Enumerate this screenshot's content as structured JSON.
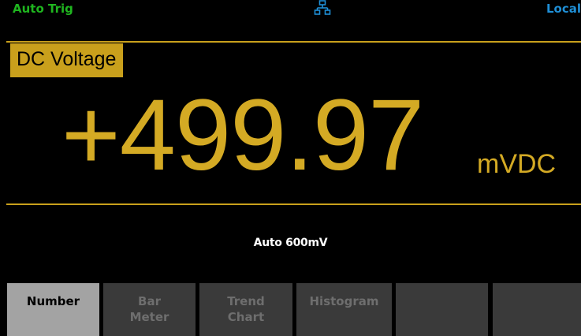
{
  "status_bar": {
    "trigger": "Auto Trig",
    "network_icon": "network-lan-icon",
    "remote_state": "Local"
  },
  "measurement": {
    "function": "DC Voltage",
    "reading": "+499.97",
    "unit": "mVDC",
    "range": "Auto  600mV"
  },
  "softkeys": [
    {
      "line1": "Number",
      "line2": "",
      "active": true
    },
    {
      "line1": "Bar",
      "line2": "Meter",
      "active": false
    },
    {
      "line1": "Trend",
      "line2": "Chart",
      "active": false
    },
    {
      "line1": "Histogram",
      "line2": "",
      "active": false
    },
    {
      "line1": "",
      "line2": "",
      "active": false
    },
    {
      "line1": "",
      "line2": "",
      "active": false
    }
  ],
  "colors": {
    "background": "#000000",
    "accent": "#c9a01c",
    "trigger_text": "#1fb51f",
    "remote_text": "#1f8fd6",
    "softkey_active": "#a3a3a3",
    "softkey_inactive": "#3a3a3a"
  }
}
